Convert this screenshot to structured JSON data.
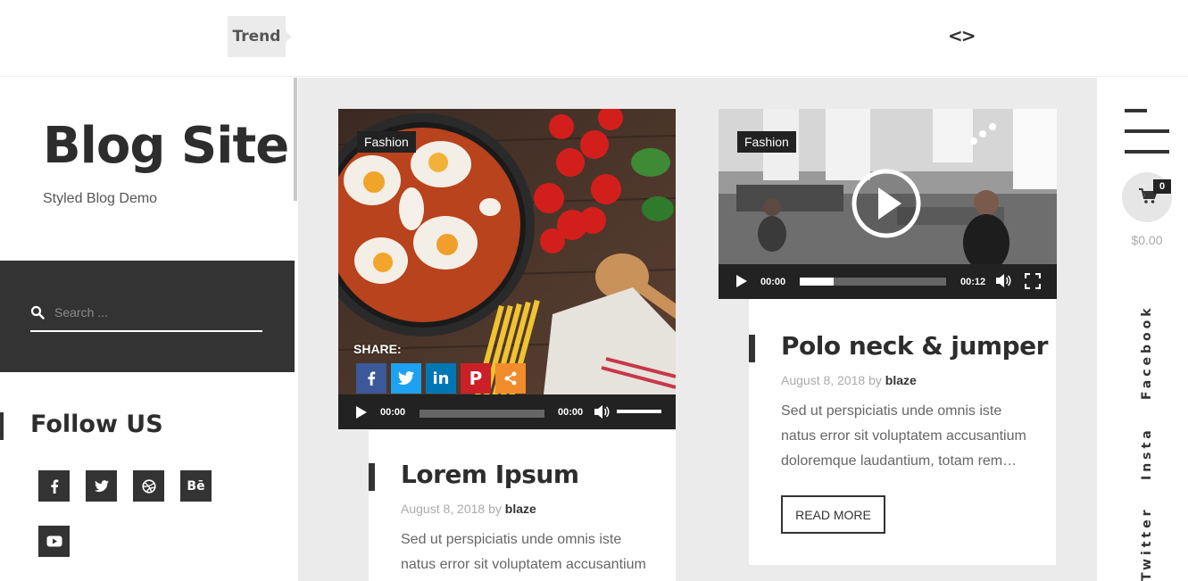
{
  "topbar": {
    "trend_label": "Trend",
    "nav_arrows": "<>"
  },
  "site": {
    "title": "Blog Site",
    "tagline": "Styled Blog Demo"
  },
  "search": {
    "placeholder": "Search ..."
  },
  "follow": {
    "title": "Follow US",
    "icons": [
      "facebook-icon",
      "twitter-icon",
      "dribbble-icon",
      "behance-icon",
      "youtube-icon"
    ],
    "behance_glyph": "Bē"
  },
  "posts": [
    {
      "category": "Fashion",
      "title": "Lorem Ipsum",
      "date": "August 8, 2018",
      "by": "by",
      "author": "blaze",
      "excerpt": "Sed ut perspiciatis unde omnis iste natus error sit voluptatem accusantium",
      "share_label": "SHARE:",
      "player": {
        "current": "00:00",
        "duration": "00:00",
        "progress": 0
      }
    },
    {
      "category": "Fashion",
      "title": "Polo neck & jumper",
      "date": "August 8, 2018",
      "by": "by",
      "author": "blaze",
      "excerpt": "Sed ut perspiciatis unde omnis iste natus error sit voluptatem accusantium doloremque laudantium, totam rem…",
      "read_more": "READ MORE",
      "player": {
        "current": "00:00",
        "duration": "00:12",
        "progress": 0.23
      }
    }
  ],
  "share_colors": {
    "facebook": "#3b5998",
    "twitter": "#1da1f2",
    "linkedin": "#0077b5",
    "pinterest": "#cb2027",
    "share": "#f08c2b"
  },
  "cart": {
    "count": "0",
    "total": "$0.00"
  },
  "side_links": [
    "Facebook",
    "Insta",
    "Twitter"
  ]
}
